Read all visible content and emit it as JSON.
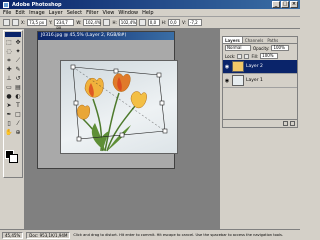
{
  "window": {
    "title": "Adobe Photoshop",
    "min": "_",
    "max": "□",
    "close": "×"
  },
  "menu": [
    "File",
    "Edit",
    "Image",
    "Layer",
    "Select",
    "Filter",
    "View",
    "Window",
    "Help"
  ],
  "options": {
    "fields": [
      {
        "label": "X:",
        "value": "73,5 px"
      },
      {
        "label": "Y:",
        "value": "234,7 px"
      },
      {
        "label": "W:",
        "value": "102,4%"
      },
      {
        "label": "H:",
        "value": "102,4%"
      },
      {
        "label": "",
        "value": "0,0"
      },
      {
        "label": "H:",
        "value": "0,0"
      },
      {
        "label": "V:",
        "value": "-7,2"
      }
    ]
  },
  "document": {
    "title": "J0316.jpg @ 45,5% (Layer 2, RGB/8#)"
  },
  "panels": {
    "tabs": [
      "Layers",
      "Channels",
      "Paths"
    ],
    "blend_mode": "Normal",
    "opacity_label": "Opacity:",
    "opacity_value": "100%",
    "lock_label": "Lock:",
    "fill_label": "Fill:",
    "fill_value": "100%",
    "layers": [
      {
        "name": "Layer 2",
        "selected": true
      },
      {
        "name": "Layer 1",
        "selected": false
      }
    ]
  },
  "status": {
    "zoom": "45,45%",
    "doc": "Doc: 953,1K/1,94M",
    "hint": "Click and drag to distort. Hit enter to commit. Hit escape to cancel. Use the spacebar to access the navigation tools."
  },
  "colors": {
    "title_bar": "#0a246a",
    "panel_bg": "#d4d0c8",
    "workspace": "#808080",
    "selection": "#0a246a"
  }
}
